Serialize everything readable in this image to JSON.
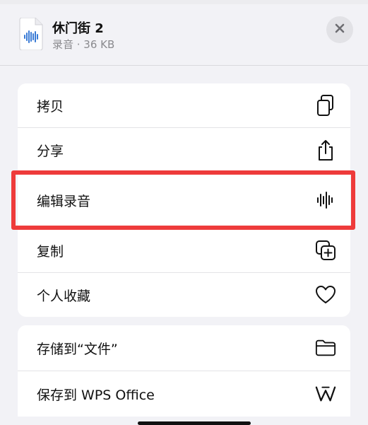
{
  "header": {
    "file_title": "休门街 2",
    "file_meta": "录音 · 36 KB",
    "icons": {
      "file": "audio-file-icon",
      "close": "close-icon"
    }
  },
  "actions_primary": [
    {
      "label": "拷贝",
      "icon": "copy-icon"
    },
    {
      "label": "分享",
      "icon": "share-icon"
    },
    {
      "label": "编辑录音",
      "icon": "waveform-icon"
    },
    {
      "label": "复制",
      "icon": "duplicate-icon"
    },
    {
      "label": "个人收藏",
      "icon": "heart-icon"
    }
  ],
  "actions_secondary": [
    {
      "label": "存储到“文件”",
      "icon": "folder-icon"
    },
    {
      "label": "保存到 WPS Office",
      "icon": "wps-logo-icon"
    }
  ],
  "colors": {
    "accent_highlight": "#ee3b3b",
    "audio_blue": "#3a7bd5",
    "background": "#f2f2f6"
  }
}
